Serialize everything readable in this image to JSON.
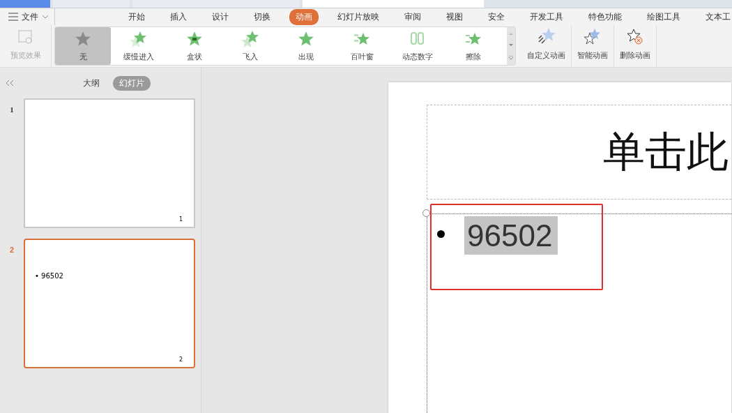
{
  "document_tabs": [
    {
      "kind": "home",
      "selected": false
    },
    {
      "kind": "doc",
      "selected": false
    },
    {
      "kind": "doc",
      "selected": false
    },
    {
      "kind": "doc",
      "selected": true
    }
  ],
  "menu": {
    "file": "文件",
    "tabs": [
      {
        "label": "开始",
        "selected": false
      },
      {
        "label": "插入",
        "selected": false
      },
      {
        "label": "设计",
        "selected": false
      },
      {
        "label": "切换",
        "selected": false
      },
      {
        "label": "动画",
        "selected": true
      },
      {
        "label": "幻灯片放映",
        "selected": false
      },
      {
        "label": "审阅",
        "selected": false
      },
      {
        "label": "视图",
        "selected": false
      },
      {
        "label": "安全",
        "selected": false
      },
      {
        "label": "开发工具",
        "selected": false
      },
      {
        "label": "特色功能",
        "selected": false
      },
      {
        "label": "绘图工具",
        "selected": false
      },
      {
        "label": "文本工",
        "selected": false
      }
    ]
  },
  "ribbon": {
    "preview": "预览效果",
    "effects": [
      {
        "label": "无",
        "selected": true,
        "kind": "none"
      },
      {
        "label": "缓慢进入",
        "selected": false,
        "kind": "slow"
      },
      {
        "label": "盒状",
        "selected": false,
        "kind": "box"
      },
      {
        "label": "飞入",
        "selected": false,
        "kind": "fly"
      },
      {
        "label": "出现",
        "selected": false,
        "kind": "appear"
      },
      {
        "label": "百叶窗",
        "selected": false,
        "kind": "blinds"
      },
      {
        "label": "动态数字",
        "selected": false,
        "kind": "digits"
      },
      {
        "label": "擦除",
        "selected": false,
        "kind": "wipe"
      }
    ],
    "actions": [
      {
        "label": "自定义动画",
        "kind": "custom"
      },
      {
        "label": "智能动画",
        "kind": "smart"
      },
      {
        "label": "删除动画",
        "kind": "delete"
      }
    ]
  },
  "sidebar": {
    "views": [
      {
        "label": "大纲",
        "selected": false
      },
      {
        "label": "幻灯片",
        "selected": true
      }
    ],
    "slides": [
      {
        "number": "1",
        "selected": false,
        "page": "1"
      },
      {
        "number": "2",
        "selected": true,
        "bullet": "• 96502",
        "page": "2"
      }
    ]
  },
  "slide": {
    "title": "单击此",
    "bullet": "96502"
  }
}
